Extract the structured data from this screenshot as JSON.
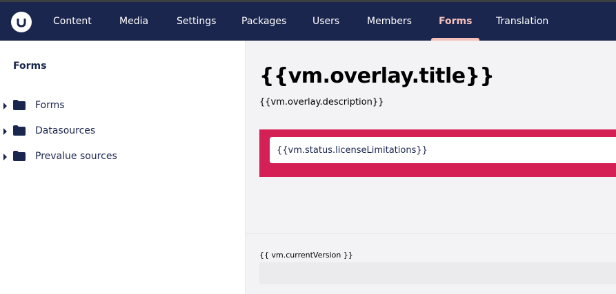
{
  "header": {
    "logo_icon": "umbraco-logo-icon",
    "nav": [
      {
        "label": "Content"
      },
      {
        "label": "Media"
      },
      {
        "label": "Settings"
      },
      {
        "label": "Packages"
      },
      {
        "label": "Users"
      },
      {
        "label": "Members"
      },
      {
        "label": "Forms",
        "active": true
      },
      {
        "label": "Translation"
      }
    ]
  },
  "sidebar": {
    "title": "Forms",
    "items": [
      {
        "label": "Forms",
        "icon": "folder-icon"
      },
      {
        "label": "Datasources",
        "icon": "folder-icon"
      },
      {
        "label": "Prevalue sources",
        "icon": "folder-icon"
      }
    ]
  },
  "main": {
    "title": "{{vm.overlay.title}}",
    "description": "{{vm.overlay.description}}",
    "alert_text": "{{vm.status.licenseLimitations}}",
    "version_text": "{{ vm.currentVersion }}"
  },
  "colors": {
    "header_bg": "#1b264f",
    "active_nav": "#f5c1bc",
    "alert_bg": "#d42054"
  }
}
